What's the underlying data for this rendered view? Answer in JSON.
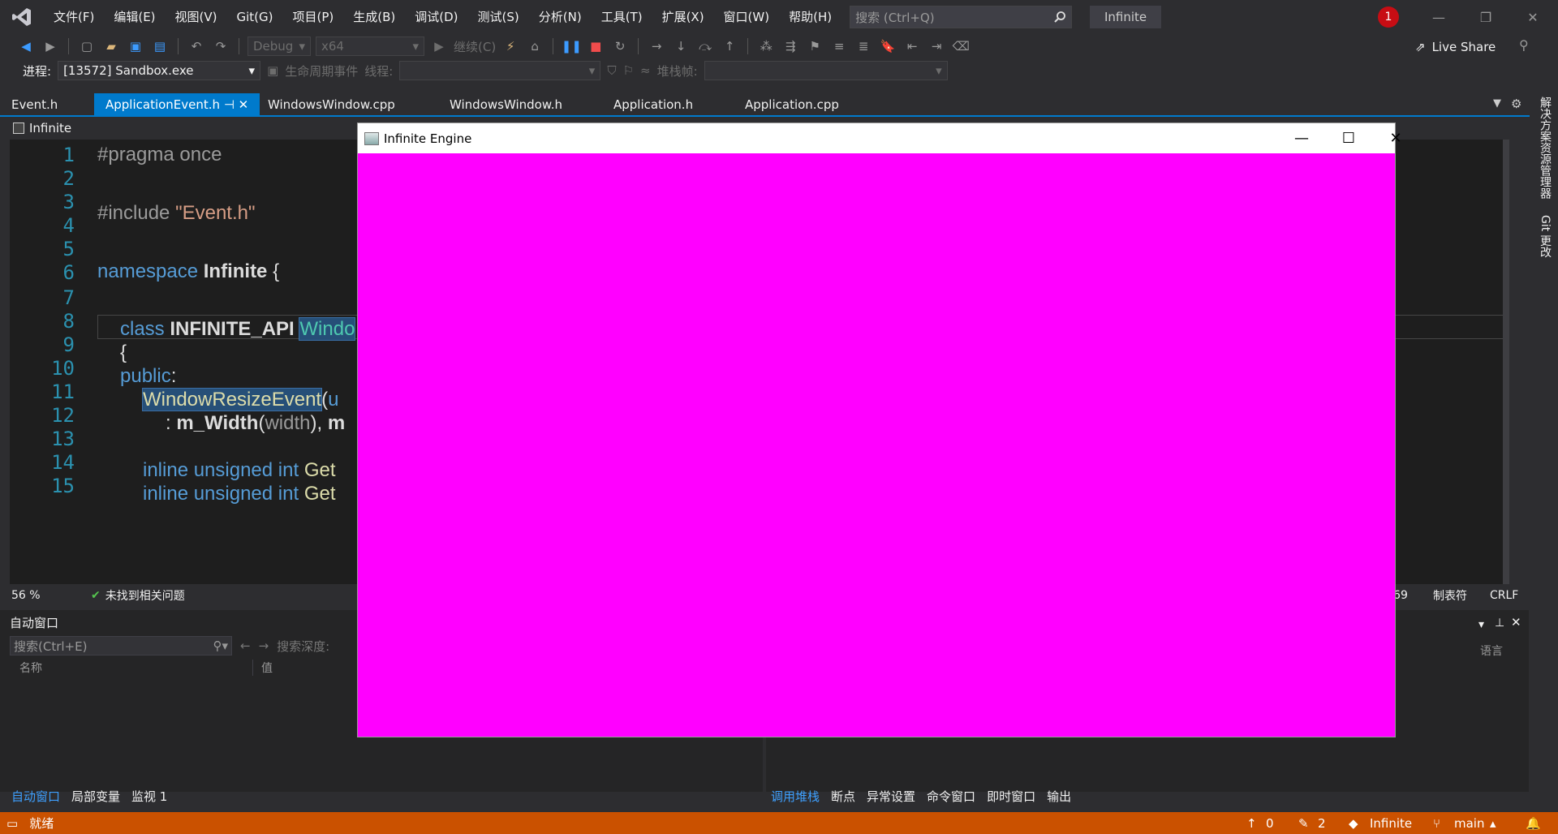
{
  "menu": {
    "items": [
      "文件(F)",
      "编辑(E)",
      "视图(V)",
      "Git(G)",
      "项目(P)",
      "生成(B)",
      "调试(D)",
      "测试(S)",
      "分析(N)",
      "工具(T)",
      "扩展(X)",
      "窗口(W)",
      "帮助(H)"
    ],
    "search_placeholder": "搜索 (Ctrl+Q)",
    "solution_name": "Infinite",
    "notification_count": "1"
  },
  "toolbar": {
    "config": "Debug",
    "platform": "x64",
    "continue_label": "继续(C)",
    "live_share": "Live Share",
    "process_label": "进程:",
    "process_value": "[13572] Sandbox.exe",
    "lifecycle_label": "生命周期事件",
    "thread_label": "线程:",
    "stack_label": "堆栈帧:"
  },
  "tabs": [
    {
      "label": "Event.h",
      "active": false
    },
    {
      "label": "ApplicationEvent.h",
      "active": true
    },
    {
      "label": "WindowsWindow.cpp",
      "active": false
    },
    {
      "label": "WindowsWindow.h",
      "active": false
    },
    {
      "label": "Application.h",
      "active": false
    },
    {
      "label": "Application.cpp",
      "active": false
    }
  ],
  "editor": {
    "project_nav": "Infinite",
    "line_numbers": [
      "1",
      "2",
      "3",
      "4",
      "5",
      "6",
      "7",
      "8",
      "9",
      "10",
      "11",
      "12",
      "13",
      "14",
      "15"
    ],
    "zoom": "56 %",
    "issues": "未找到相关问题",
    "cursor_pos": "ⅰ: 69",
    "indent_mode": "制表符",
    "line_ending": "CRLF"
  },
  "auto_panel": {
    "title": "自动窗口",
    "search_placeholder": "搜索(Ctrl+E)",
    "search_depth": "搜索深度:",
    "col_name": "名称",
    "col_value": "值",
    "col_lang": "语言"
  },
  "bottom_tabs_left": [
    "自动窗口",
    "局部变量",
    "监视 1"
  ],
  "bottom_tabs_right": [
    "调用堆栈",
    "断点",
    "异常设置",
    "命令窗口",
    "即时窗口",
    "输出"
  ],
  "status": {
    "ready": "就绪",
    "up_count": "0",
    "edit_count": "2",
    "repo": "Infinite",
    "branch": "main"
  },
  "side_strip": [
    "解决方案资源管理器",
    "Git 更改"
  ],
  "app_window": {
    "title": "Infinite Engine",
    "fill_color": "#ff00ff"
  },
  "colors": {
    "accent": "#007acc",
    "status_bar": "#ca5100"
  }
}
